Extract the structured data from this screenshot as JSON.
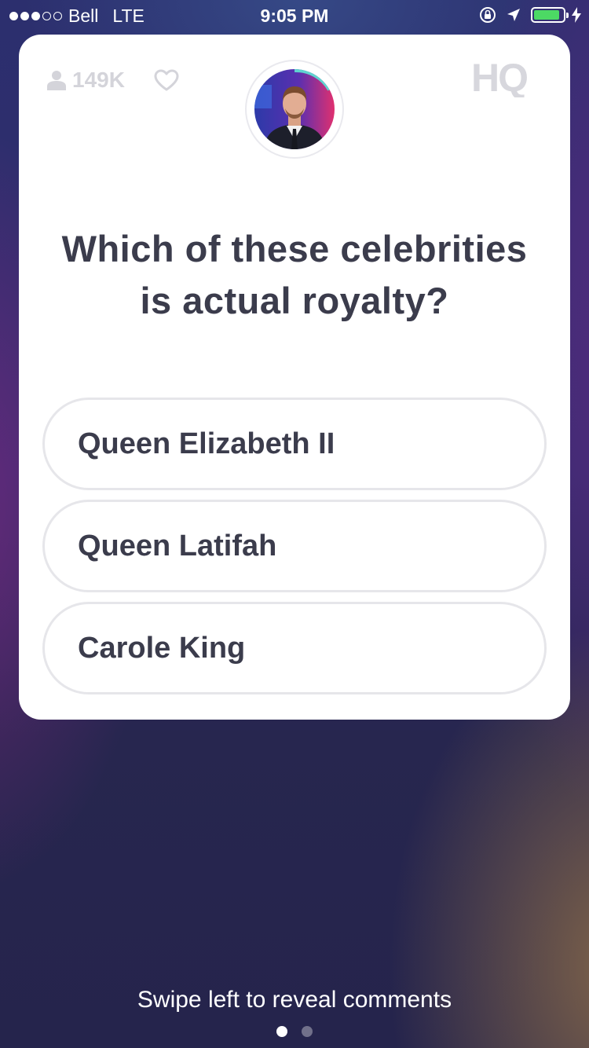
{
  "status_bar": {
    "carrier": "Bell",
    "network": "LTE",
    "time": "9:05 PM",
    "signal_bars_filled": 3,
    "signal_bars_total": 5,
    "battery_level": 0.9,
    "battery_color": "#4cd964"
  },
  "game": {
    "viewer_count": "149K",
    "logo_text": "HQ",
    "question": "Which of these celebrities is actual royalty?",
    "timer_color": "#5fd3d0",
    "answers": [
      {
        "label": "Queen Elizabeth II"
      },
      {
        "label": "Queen Latifah"
      },
      {
        "label": "Carole King"
      }
    ]
  },
  "footer": {
    "hint": "Swipe left to reveal comments",
    "page_count": 2,
    "active_page": 1
  },
  "icons": {
    "viewers": "person-icon",
    "like": "heart-icon",
    "location": "location-arrow-icon",
    "rotation_lock": "rotation-lock-icon",
    "charging": "bolt-icon"
  },
  "colors": {
    "card": "#ffffff",
    "text_dark": "#3b3c4c",
    "text_muted": "#d4d4da",
    "answer_border": "#e6e6ea"
  }
}
